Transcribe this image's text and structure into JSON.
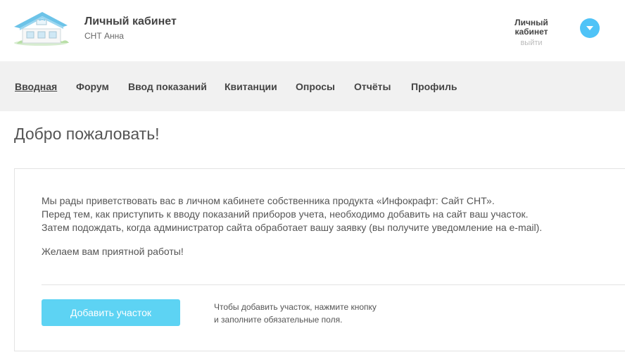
{
  "header": {
    "title": "Личный кабинет",
    "subtitle": "СНТ Анна",
    "user_name_line1": "Личный",
    "user_name_line2": "кабинет",
    "logout_label": "выйти",
    "accent_color": "#4fc3f7",
    "menu_icon": "chevron-down-icon"
  },
  "nav": {
    "items": [
      {
        "label": "Вводная",
        "active": true
      },
      {
        "label": "Форум"
      },
      {
        "label": "Ввод показаний"
      },
      {
        "label": "Квитанции"
      },
      {
        "label": "Опросы"
      },
      {
        "label": "Отчёты"
      },
      {
        "label": "Профиль"
      }
    ]
  },
  "main": {
    "title": "Добро пожаловать!",
    "intro_lines": [
      "Мы рады приветствовать вас в личном кабинете собственника продукта «Инфокрафт: Сайт СНТ».",
      "Перед тем, как приступить к вводу показаний приборов учета, необходимо добавить на сайт ваш участок.",
      "Затем подождать, когда администратор сайта обработает вашу заявку (вы получите уведомление на e-mail)."
    ],
    "wish": "Желаем вам приятной работы!",
    "add_button_label": "Добавить участок",
    "add_button_color": "#5dd3f3",
    "hint_lines": [
      "Чтобы добавить участок, нажмите кнопку",
      "и заполните обязательные поля."
    ]
  }
}
